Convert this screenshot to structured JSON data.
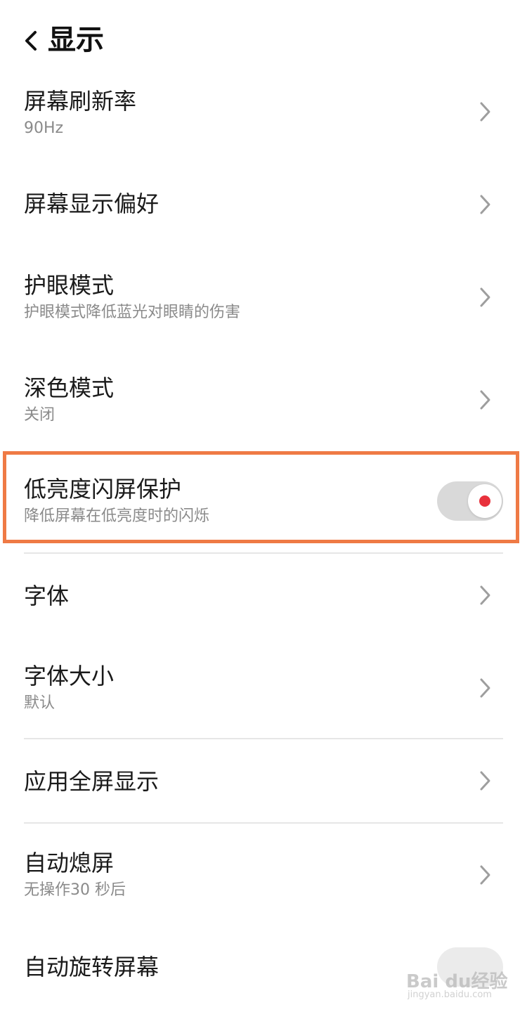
{
  "header": {
    "title": "显示"
  },
  "items": [
    {
      "title": "屏幕刷新率",
      "sub": "90Hz"
    },
    {
      "title": "屏幕显示偏好"
    },
    {
      "title": "护眼模式",
      "sub": "护眼模式降低蓝光对眼睛的伤害"
    },
    {
      "title": "深色模式",
      "sub": "关闭"
    },
    {
      "title": "低亮度闪屏保护",
      "sub": "降低屏幕在低亮度时的闪烁"
    },
    {
      "title": "字体"
    },
    {
      "title": "字体大小",
      "sub": "默认"
    },
    {
      "title": "应用全屏显示"
    },
    {
      "title": "自动熄屏",
      "sub": "无操作30 秒后"
    },
    {
      "title": "自动旋转屏幕"
    }
  ],
  "toggle": {
    "low_brightness_flicker": true
  },
  "colors": {
    "highlight": "#ef7a45",
    "toggle_dot": "#e8313c",
    "toggle_track": "#d9d9d9"
  },
  "icons": {
    "back": "chevron-left-icon",
    "row_arrow": "chevron-right-icon"
  },
  "watermark": {
    "text": "Bai du经验",
    "sub": "jingyan.baidu.com"
  }
}
